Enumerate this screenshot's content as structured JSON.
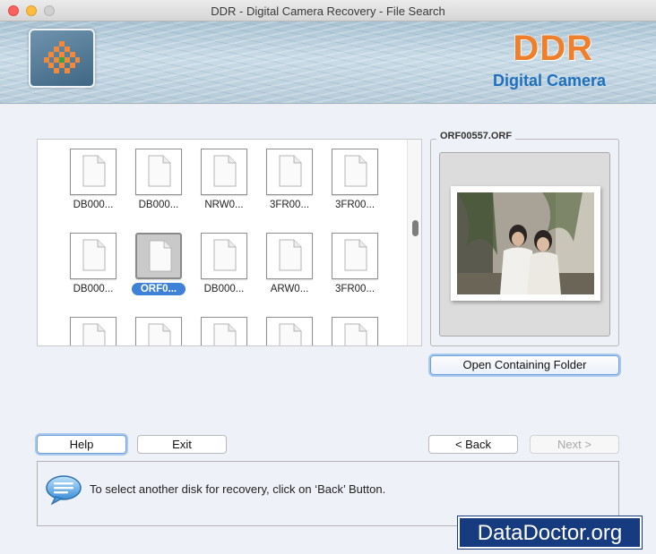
{
  "window": {
    "title": "DDR - Digital Camera Recovery - File Search"
  },
  "header": {
    "brand": "DDR",
    "product": "Digital Camera",
    "logo_icon": "ddr-logo-icon"
  },
  "files": [
    {
      "name": "DB000...",
      "selected": false
    },
    {
      "name": "DB000...",
      "selected": false
    },
    {
      "name": "NRW0...",
      "selected": false
    },
    {
      "name": "3FR00...",
      "selected": false
    },
    {
      "name": "3FR00...",
      "selected": false
    },
    {
      "name": "DB000...",
      "selected": false
    },
    {
      "name": "ORF0...",
      "selected": true
    },
    {
      "name": "DB000...",
      "selected": false
    },
    {
      "name": "ARW0...",
      "selected": false
    },
    {
      "name": "3FR00...",
      "selected": false
    }
  ],
  "preview": {
    "filename": "ORF00557.ORF",
    "open_folder_label": "Open Containing Folder"
  },
  "buttons": {
    "help": "Help",
    "exit": "Exit",
    "back": "< Back",
    "next": "Next >"
  },
  "status": {
    "icon": "speech-bubble-icon",
    "message": "To select another disk for recovery, click on ‘Back’ Button."
  },
  "watermark": "DataDoctor.org",
  "colors": {
    "brand_orange": "#ef7f2a",
    "brand_blue": "#1f6fbf",
    "selection_blue": "#3d82d8",
    "watermark_bg": "#163b7f"
  }
}
